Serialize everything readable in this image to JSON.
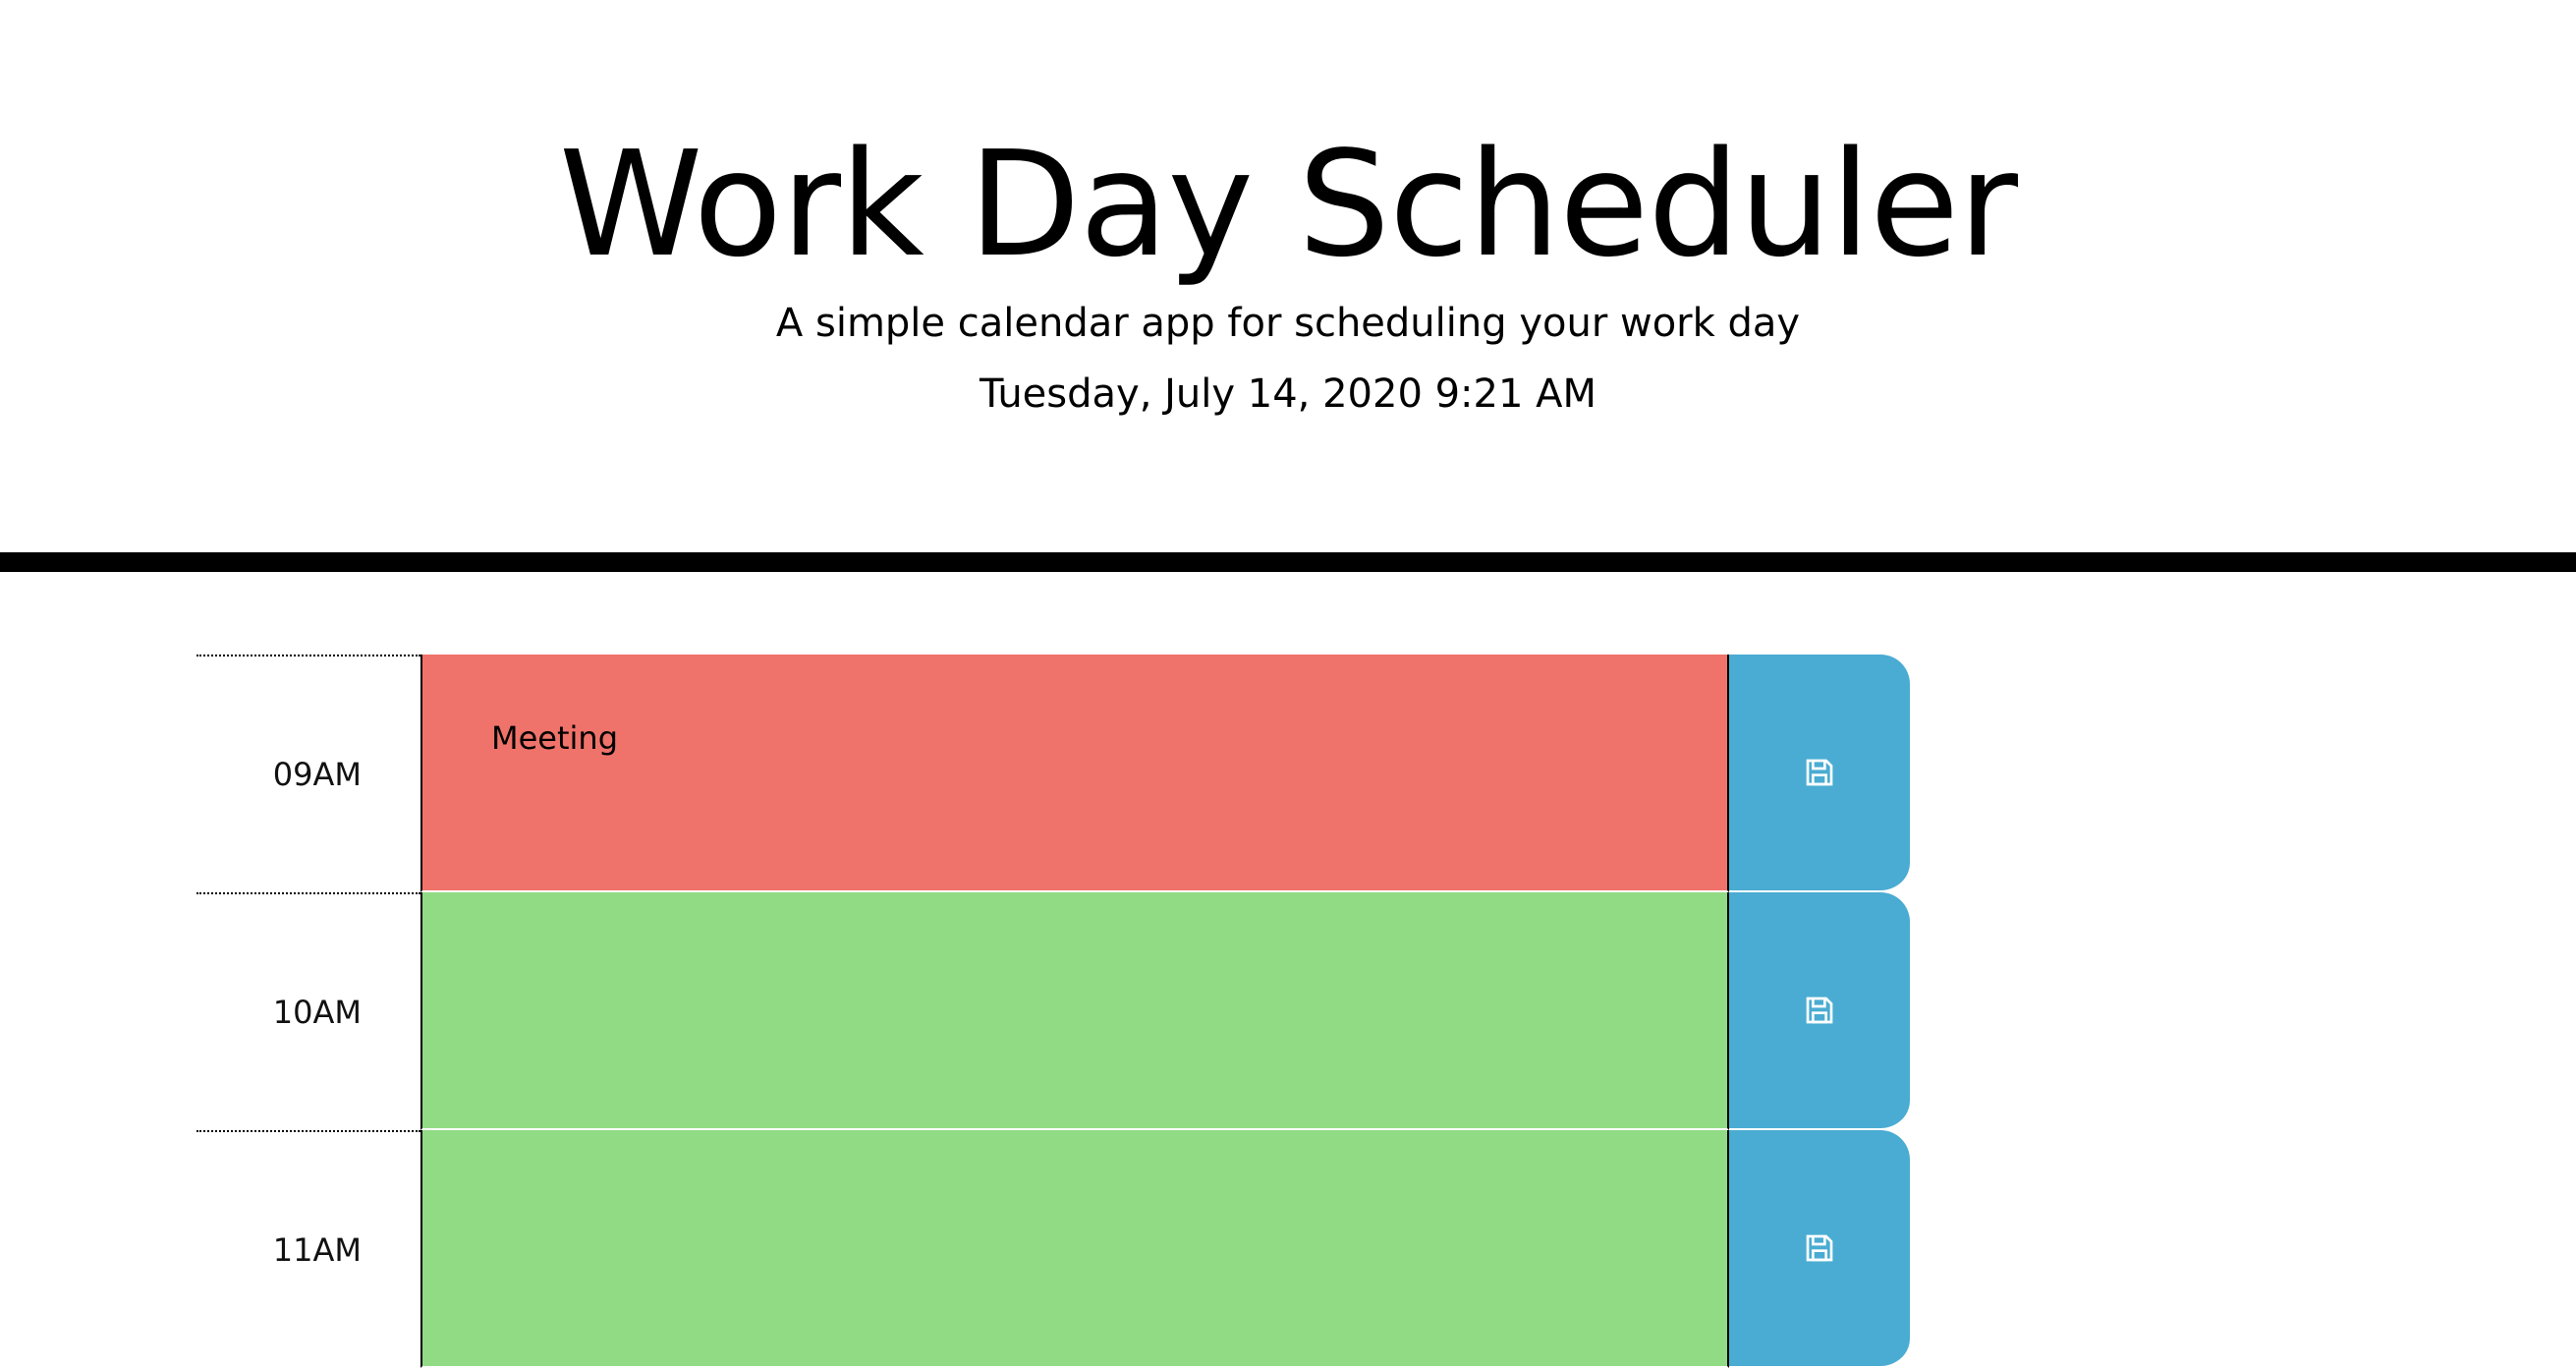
{
  "header": {
    "title": "Work Day Scheduler",
    "lead": "A simple calendar app for scheduling your work day",
    "current_day": "Tuesday, July 14, 2020 9:21 AM"
  },
  "colors": {
    "past": "#ef736a",
    "future": "#91db85",
    "save_button": "#4aacd2",
    "divider": "#000000"
  },
  "timeblocks": [
    {
      "hour": "09AM",
      "text": "Meeting",
      "state": "past",
      "save_icon": "floppy-disk-icon"
    },
    {
      "hour": "10AM",
      "text": "",
      "state": "future",
      "save_icon": "floppy-disk-icon"
    },
    {
      "hour": "11AM",
      "text": "",
      "state": "future",
      "save_icon": "floppy-disk-icon"
    }
  ]
}
